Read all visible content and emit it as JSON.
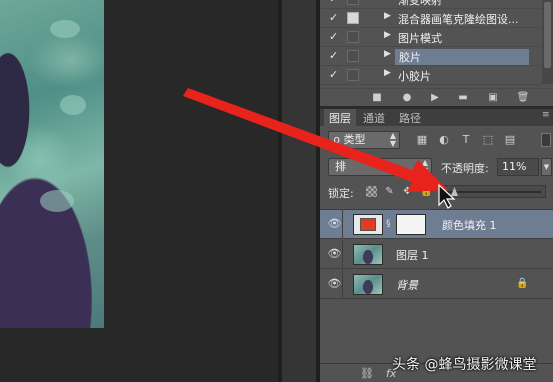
{
  "actions": {
    "items": [
      {
        "check": "✓",
        "dialog": false,
        "label": "渐变映射",
        "selected": false
      },
      {
        "check": "✓",
        "dialog": true,
        "label": "混合器画笔克隆绘图设...",
        "selected": false
      },
      {
        "check": "✓",
        "dialog": false,
        "label": "图片模式",
        "selected": false
      },
      {
        "check": "✓",
        "dialog": false,
        "label": "胶片",
        "selected": true
      },
      {
        "check": "✓",
        "dialog": false,
        "label": "小胶片",
        "selected": false
      }
    ],
    "toolbar_icons": [
      "stop-icon",
      "record-icon",
      "play-icon",
      "new-set-icon",
      "new-action-icon",
      "delete-icon"
    ]
  },
  "layers_panel": {
    "tabs": [
      "图层",
      "通道",
      "路径"
    ],
    "active_tab": "图层",
    "filter": {
      "label": "ρ 类型"
    },
    "blend": {
      "label": "排",
      "opacity_label": "不透明度:",
      "opacity_value": "11%"
    },
    "lock": {
      "label": "锁定:"
    },
    "layers": [
      {
        "name": "颜色填充 1",
        "type": "fill",
        "selected": true,
        "visible": true,
        "locked": false
      },
      {
        "name": "图层 1",
        "type": "photo",
        "selected": false,
        "visible": true,
        "locked": false
      },
      {
        "name": "背景",
        "type": "photo",
        "selected": false,
        "visible": true,
        "locked": true
      }
    ],
    "footer_icons": [
      "link-icon",
      "fx-icon"
    ]
  },
  "watermark": "头条 @蜂鸟摄影微课堂",
  "colors": {
    "selection": "#6f7d93",
    "panel": "#535353",
    "annotation_arrow": "#e8231c",
    "fill_swatch": "#e13b23"
  }
}
